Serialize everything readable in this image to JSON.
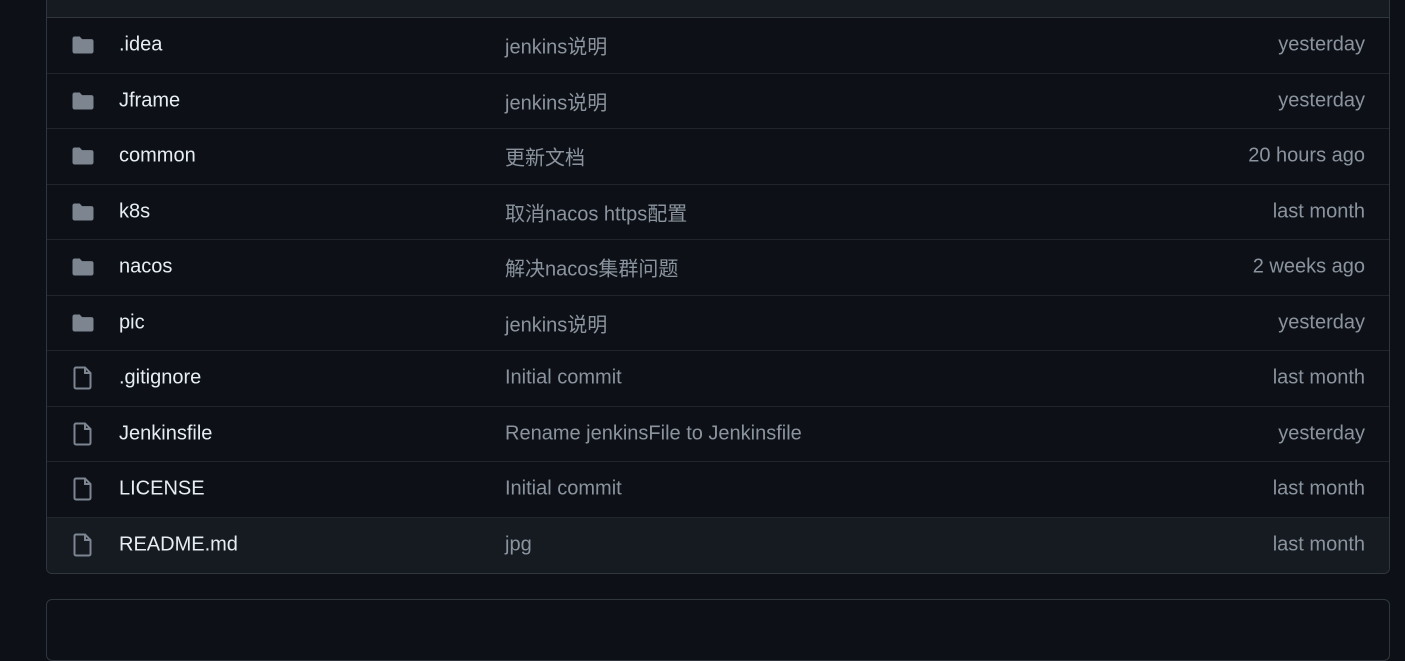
{
  "colors": {
    "background": "#0d1117",
    "row_hover": "#161b22",
    "border": "#30363d",
    "folder_icon": "#7d8590",
    "file_icon": "#7d8590",
    "name_text": "#e6edf3",
    "muted_text": "#8b949e"
  },
  "files": [
    {
      "icon": "folder-icon",
      "name": ".idea",
      "commit": "jenkins说明",
      "date": "yesterday"
    },
    {
      "icon": "folder-icon",
      "name": "Jframe",
      "commit": "jenkins说明",
      "date": "yesterday"
    },
    {
      "icon": "folder-icon",
      "name": "common",
      "commit": "更新文档",
      "date": "20 hours ago"
    },
    {
      "icon": "folder-icon",
      "name": "k8s",
      "commit": "取消nacos https配置",
      "date": "last month"
    },
    {
      "icon": "folder-icon",
      "name": "nacos",
      "commit": "解决nacos集群问题",
      "date": "2 weeks ago"
    },
    {
      "icon": "folder-icon",
      "name": "pic",
      "commit": "jenkins说明",
      "date": "yesterday"
    },
    {
      "icon": "file-icon",
      "name": ".gitignore",
      "commit": "Initial commit",
      "date": "last month"
    },
    {
      "icon": "file-icon",
      "name": "Jenkinsfile",
      "commit": "Rename jenkinsFile to Jenkinsfile",
      "date": "yesterday"
    },
    {
      "icon": "file-icon",
      "name": "LICENSE",
      "commit": "Initial commit",
      "date": "last month"
    },
    {
      "icon": "file-icon",
      "name": "README.md",
      "commit": "jpg",
      "date": "last month"
    }
  ]
}
